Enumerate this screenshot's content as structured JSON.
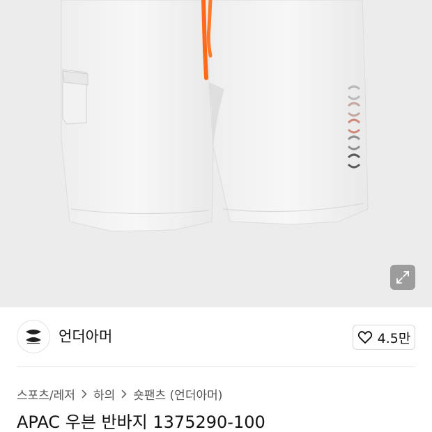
{
  "brand": {
    "name": "언더아머",
    "logo_icon": "under-armour-logo-icon"
  },
  "like": {
    "icon": "heart-outline-icon",
    "count": "4.5만"
  },
  "image_controls": {
    "expand_icon": "expand-arrows-icon"
  },
  "breadcrumb": [
    "스포츠/레저",
    "하의",
    "숏팬츠 (언더아머)"
  ],
  "product": {
    "title": "APAC 우븐 반바지 1375290-100"
  },
  "colors": {
    "image_background": "#ececec",
    "drawstring": "#ff6a1a",
    "text_primary": "#111111",
    "text_secondary": "#555555"
  }
}
